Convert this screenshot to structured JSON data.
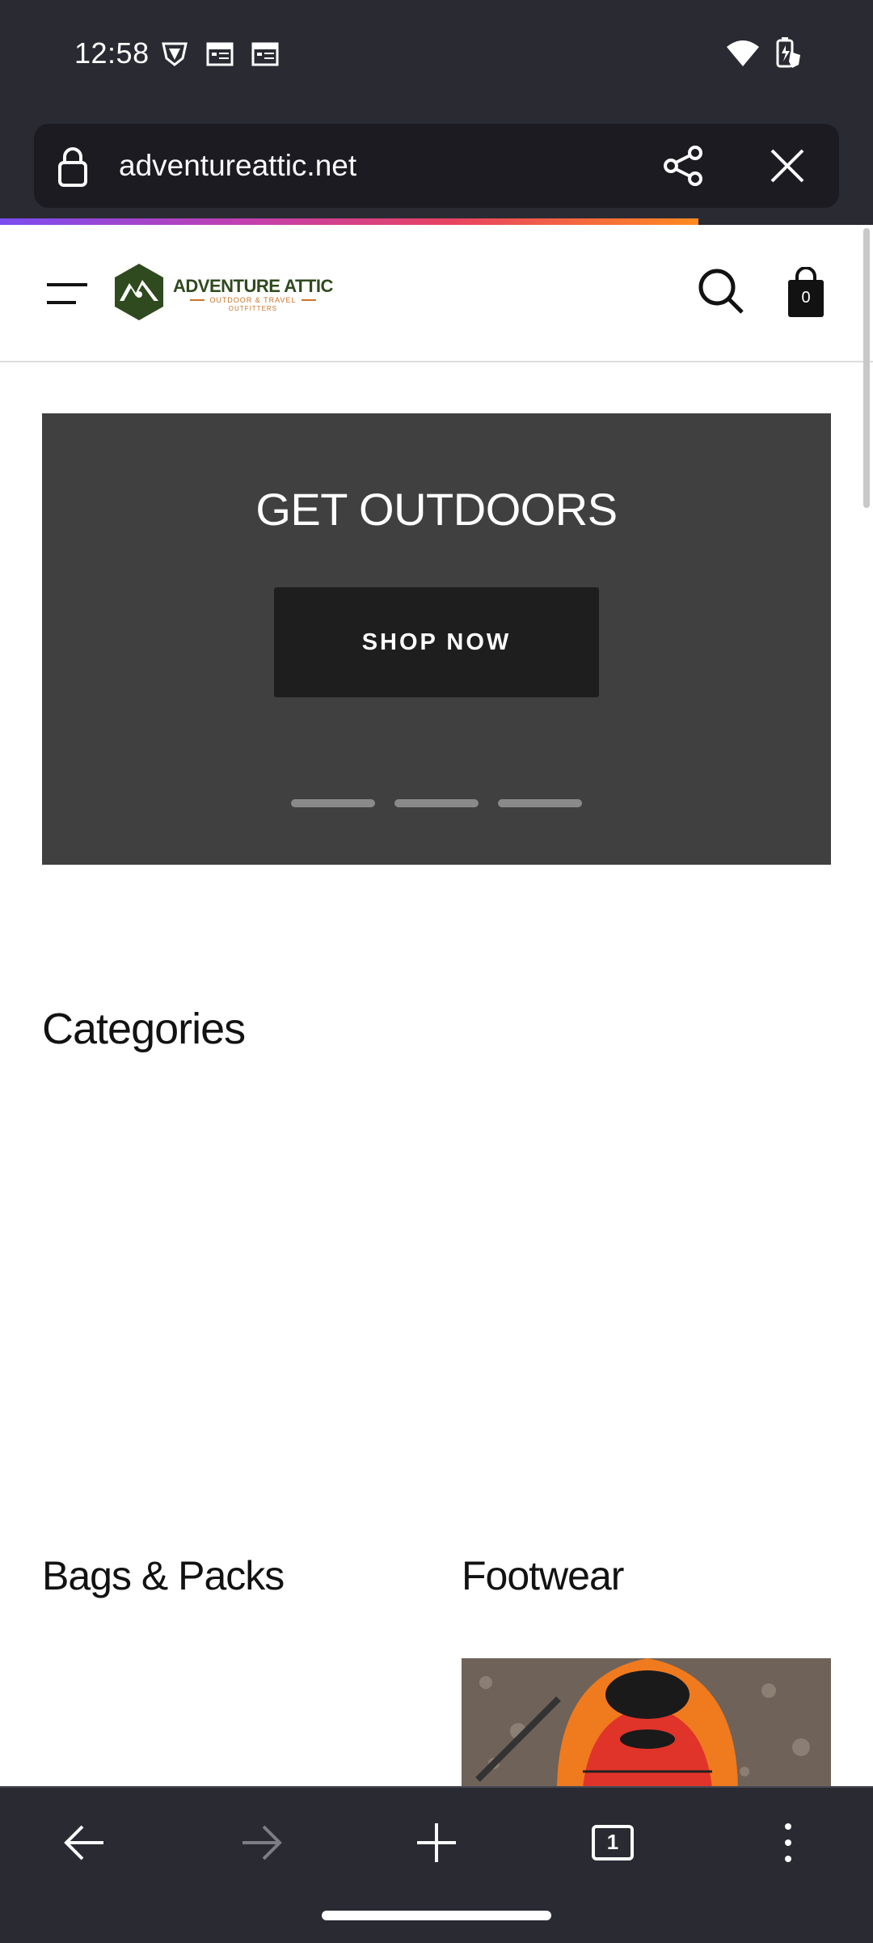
{
  "status_bar": {
    "time": "12:58",
    "left_icons": [
      "vpn-shield-icon",
      "calendar-icon",
      "calendar-icon"
    ],
    "right_icons": [
      "wifi-icon",
      "battery-charging-icon"
    ]
  },
  "browser": {
    "url": "adventureattic.net",
    "lock_icon": "lock-icon",
    "share_icon": "share-icon",
    "close_icon": "close-icon",
    "load_progress": 0.8
  },
  "site": {
    "logo": {
      "title": "ADVENTURE ATTIC",
      "subtitle": "OUTDOOR & TRAVEL",
      "subtitle2": "OUTFITTERS"
    },
    "cart_count": "0"
  },
  "hero": {
    "title": "GET OUTDOORS",
    "button_label": "SHOP NOW",
    "slide_count": 3
  },
  "sections": {
    "categories_title": "Categories",
    "bags_title": "Bags & Packs",
    "footwear_title": "Footwear"
  },
  "bottom_nav": {
    "tab_count": "1",
    "items": [
      "back-arrow-icon",
      "forward-arrow-icon",
      "new-tab-icon",
      "tabs-icon",
      "more-menu-icon"
    ]
  },
  "colors": {
    "chrome_bg": "#2a2a33",
    "url_bar_bg": "#1c1b22",
    "hero_bg": "#404040",
    "hero_button_bg": "#1e1e1e",
    "logo_green": "#2f4a1f",
    "logo_orange": "#c9742a"
  }
}
